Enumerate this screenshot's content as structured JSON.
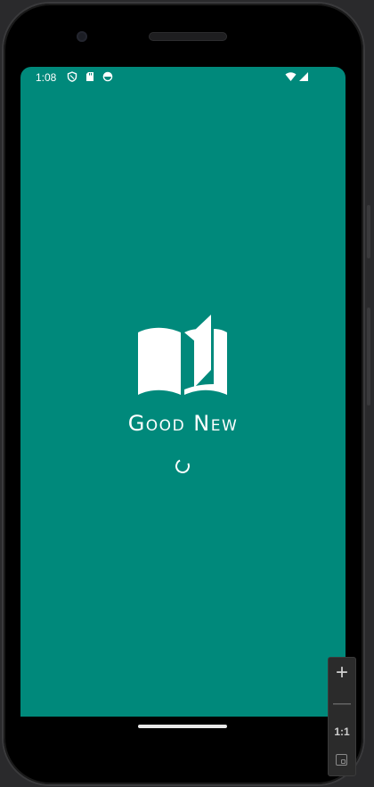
{
  "status_bar": {
    "time": "1:08",
    "icons_left": [
      "shield-icon",
      "sd-card-icon",
      "data-saver-icon"
    ],
    "icons_right": [
      "wifi-icon",
      "signal-icon"
    ]
  },
  "splash": {
    "app_name": "Good New",
    "logo_icon": "open-book-icon",
    "loading_indicator": "spinner"
  },
  "emulator_controls": {
    "zoom_in_label": "+",
    "zoom_out_label": "—",
    "actual_size_label": "1:1",
    "fit_icon": "zoom-fit-icon"
  },
  "colors": {
    "background": "#00897b",
    "foreground": "#ffffff"
  }
}
